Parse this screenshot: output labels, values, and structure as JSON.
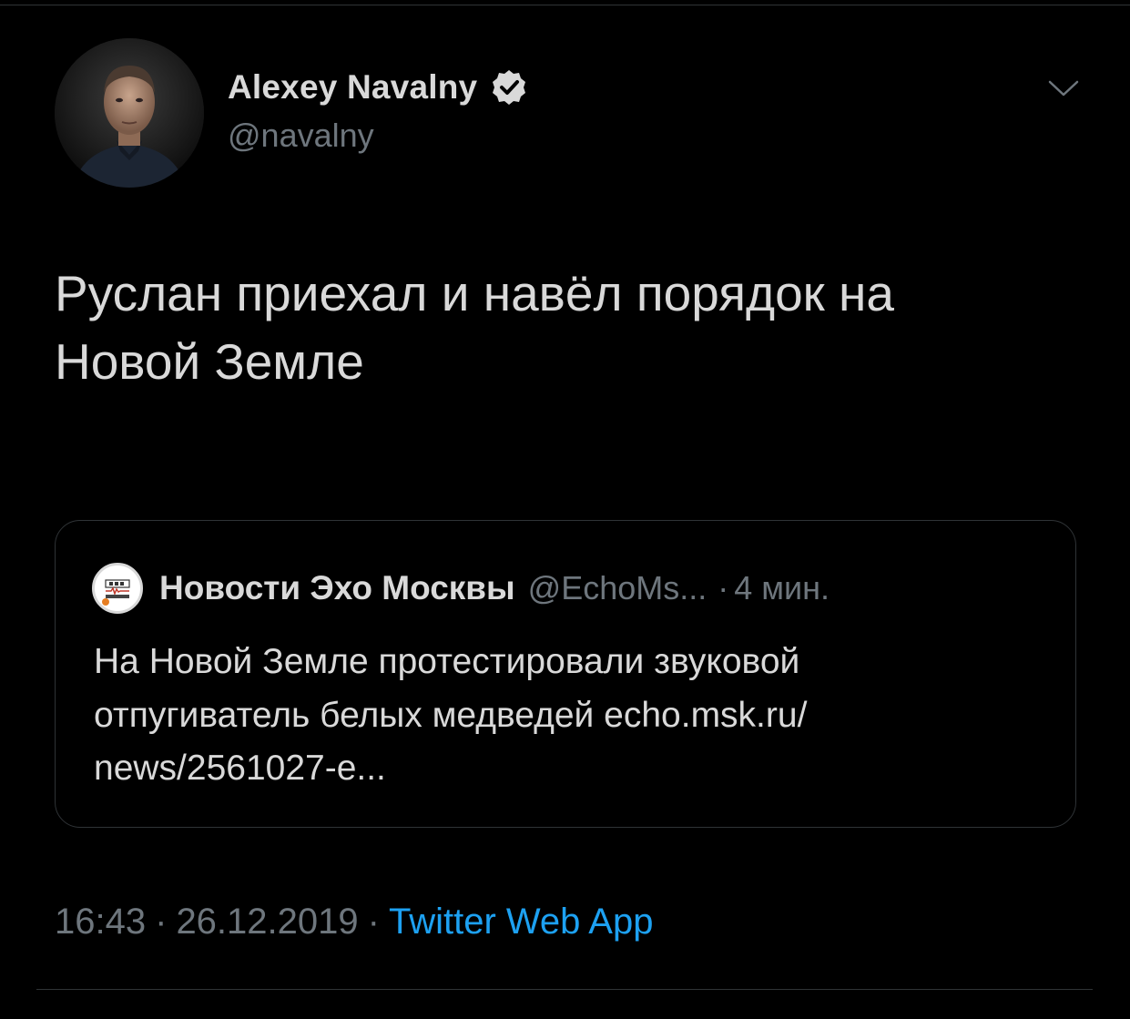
{
  "author": {
    "name": "Alexey Navalny",
    "handle": "@navalny",
    "verified_icon": "verified-badge-icon"
  },
  "menu_icon": "chevron-down-icon",
  "tweet": {
    "text_line1": "Руслан приехал и навёл порядок на",
    "text_line2": "Новой Земле"
  },
  "quoted_tweet": {
    "author_name": "Новости Эхо Москвы",
    "author_handle": "@EchoMs...",
    "separator": "·",
    "time": "4 мин.",
    "avatar_icon": "echo-moskvy-logo-icon",
    "text_line1": "На Новой Земле протестировали звуковой",
    "text_line2": "отпугиватель белых медведей echo.msk.ru/",
    "text_line3": "news/2561027-e..."
  },
  "meta": {
    "time": "16:43",
    "date": "26.12.2019",
    "separator": "·",
    "source": "Twitter Web App"
  },
  "colors": {
    "background": "#000000",
    "primary_text": "#d9d9d9",
    "secondary_text": "#6e767d",
    "link": "#1da1f2",
    "border": "#2f3336"
  }
}
